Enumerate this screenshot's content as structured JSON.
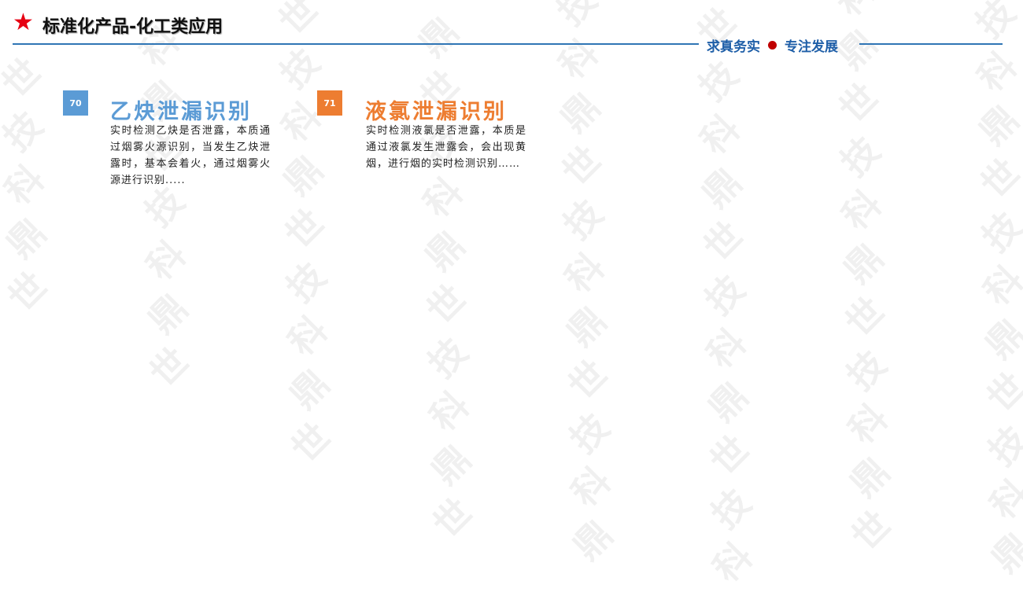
{
  "header": {
    "title": "标准化产品-化工类应用",
    "slogan_left": "求真务实",
    "slogan_right": "专注发展",
    "star_icon": "star-icon",
    "colors": {
      "star": "#e60012",
      "rule": "#2f75b5",
      "slogan": "#1f5fa8",
      "dot": "#c00000"
    }
  },
  "watermark": {
    "chars": [
      "世",
      "鼎",
      "科",
      "技"
    ]
  },
  "items": [
    {
      "number": "70",
      "title": "乙炔泄漏识别",
      "description": "实时检测乙炔是否泄露，本质通过烟雾火源识别，当发生乙炔泄露时，基本会着火，通过烟雾火源进行识别.....",
      "color": "#5b9bd5"
    },
    {
      "number": "71",
      "title": "液氯泄漏识别",
      "description": "实时检测液氯是否泄露，本质是通过液氯发生泄露会，会出现黄烟，进行烟的实时检测识别……",
      "color": "#ed7d31"
    }
  ]
}
